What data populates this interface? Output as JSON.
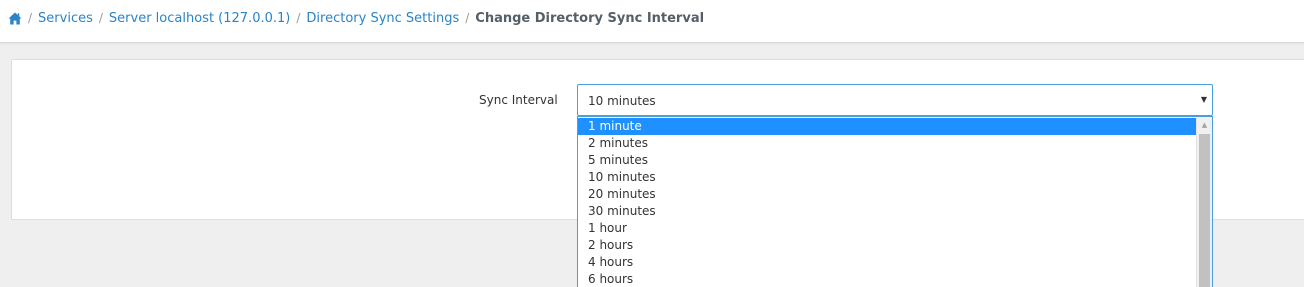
{
  "breadcrumb": {
    "home_icon": "home-icon",
    "separator": "/",
    "items": [
      {
        "label": "Services"
      },
      {
        "label": "Server localhost (127.0.0.1)"
      },
      {
        "label": "Directory Sync Settings"
      }
    ],
    "current": "Change Directory Sync Interval"
  },
  "form": {
    "sync_interval": {
      "label": "Sync Interval",
      "value": "10 minutes",
      "arrow": "▼",
      "options": [
        {
          "label": "1 minute",
          "highlighted": true
        },
        {
          "label": "2 minutes"
        },
        {
          "label": "5 minutes"
        },
        {
          "label": "10 minutes"
        },
        {
          "label": "20 minutes"
        },
        {
          "label": "30 minutes"
        },
        {
          "label": "1 hour"
        },
        {
          "label": "2 hours"
        },
        {
          "label": "4 hours"
        },
        {
          "label": "6 hours"
        }
      ]
    }
  },
  "scrollbar": {
    "up_arrow": "▲"
  },
  "colors": {
    "link": "#2a84c6",
    "focus_border": "#4a9ede",
    "highlight": "#1e90ff",
    "background": "#efefef"
  }
}
